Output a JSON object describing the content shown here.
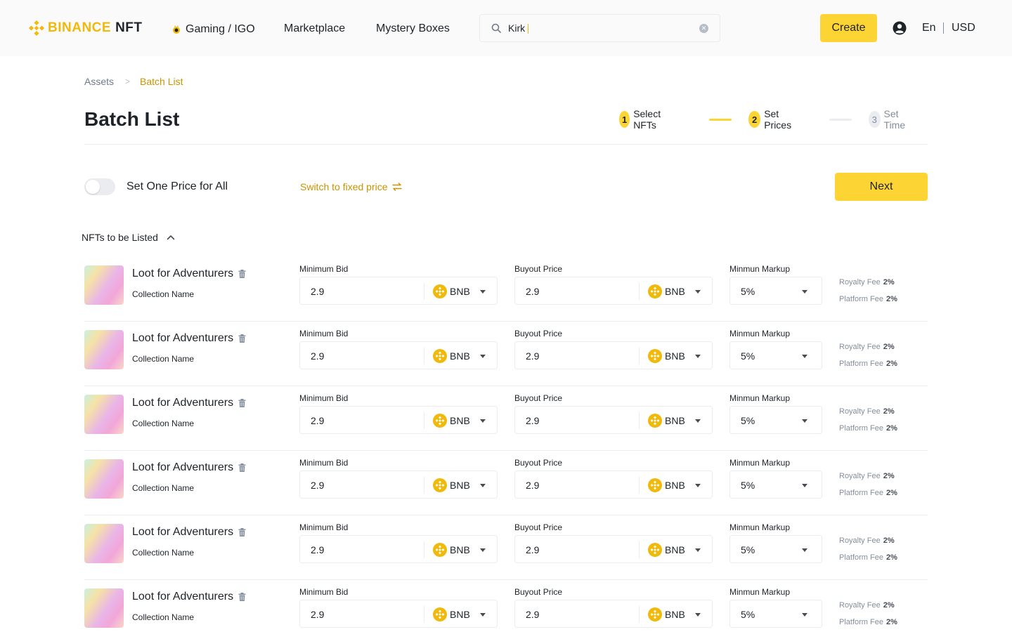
{
  "header": {
    "logo_text": "BINANCE",
    "logo_suffix": "NFT",
    "nav": {
      "gaming": "Gaming / IGO",
      "marketplace": "Marketplace",
      "mystery": "Mystery Boxes"
    },
    "search_value": "Kirk",
    "create_label": "Create",
    "language": "En",
    "currency": "USD"
  },
  "breadcrumb": {
    "parent": "Assets",
    "current": "Batch List"
  },
  "page": {
    "title": "Batch List"
  },
  "steps": [
    {
      "num": "1",
      "label": "Select NFTs"
    },
    {
      "num": "2",
      "label": "Set Prices"
    },
    {
      "num": "3",
      "label": "Set Time"
    }
  ],
  "controls": {
    "toggle_label": "Set One Price for All",
    "switch_link": "Switch to fixed price",
    "next_label": "Next"
  },
  "section": {
    "title": "NFTs to be Listed"
  },
  "labels": {
    "min_bid": "Minimum Bid",
    "buyout": "Buyout Price",
    "markup": "Minmun Markup",
    "royalty": "Royalty Fee",
    "platform": "Platform Fee"
  },
  "rows": [
    {
      "name": "Loot for Adventurers",
      "collection": "Collection Name",
      "min_bid": "2.9",
      "min_bid_coin": "BNB",
      "buyout": "2.9",
      "buyout_coin": "BNB",
      "markup": "5%",
      "royalty": "2%",
      "platform": "2%"
    },
    {
      "name": "Loot for Adventurers",
      "collection": "Collection Name",
      "min_bid": "2.9",
      "min_bid_coin": "BNB",
      "buyout": "2.9",
      "buyout_coin": "BNB",
      "markup": "5%",
      "royalty": "2%",
      "platform": "2%"
    },
    {
      "name": "Loot for Adventurers",
      "collection": "Collection Name",
      "min_bid": "2.9",
      "min_bid_coin": "BNB",
      "buyout": "2.9",
      "buyout_coin": "BNB",
      "markup": "5%",
      "royalty": "2%",
      "platform": "2%"
    },
    {
      "name": "Loot for Adventurers",
      "collection": "Collection Name",
      "min_bid": "2.9",
      "min_bid_coin": "BNB",
      "buyout": "2.9",
      "buyout_coin": "BNB",
      "markup": "5%",
      "royalty": "2%",
      "platform": "2%"
    },
    {
      "name": "Loot for Adventurers",
      "collection": "Collection Name",
      "min_bid": "2.9",
      "min_bid_coin": "BNB",
      "buyout": "2.9",
      "buyout_coin": "BNB",
      "markup": "5%",
      "royalty": "2%",
      "platform": "2%"
    },
    {
      "name": "Loot for Adventurers",
      "collection": "Collection Name",
      "min_bid": "2.9",
      "min_bid_coin": "BNB",
      "buyout": "2.9",
      "buyout_coin": "BNB",
      "markup": "5%",
      "royalty": "2%",
      "platform": "2%"
    }
  ],
  "colors": {
    "brand_yellow": "#fcd535",
    "brand_gold": "#f0b90b",
    "link_gold": "#c99400"
  },
  "icons": {
    "logo": "binance-diamond-icon",
    "search": "search-icon",
    "clear": "clear-icon",
    "user": "user-icon",
    "trash": "trash-icon",
    "coin": "bnb-coin-icon",
    "swap": "swap-icon",
    "collapse": "chevron-up-icon"
  }
}
